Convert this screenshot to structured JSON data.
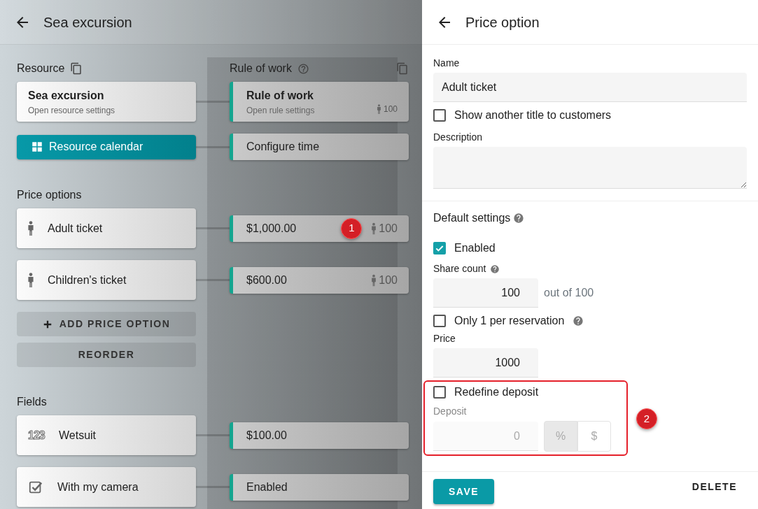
{
  "board": {
    "title": "Sea excursion",
    "rule_column": {
      "label": "Rule of work"
    },
    "sections": [
      {
        "label": "Resource",
        "rows": [
          {
            "kind": "resource",
            "title": "Sea excursion",
            "subtitle": "Open resource settings",
            "rule": {
              "title": "Rule of work",
              "subtitle": "Open rule settings",
              "count": "100"
            }
          },
          {
            "kind": "calendar",
            "title": "Resource calendar",
            "rule": {
              "title": "Configure time"
            }
          }
        ]
      },
      {
        "label": "Price options",
        "rows": [
          {
            "kind": "person",
            "title": "Adult ticket",
            "rule": {
              "title": "$1,000.00",
              "count": "100",
              "marker": "1"
            }
          },
          {
            "kind": "person",
            "title": "Children's ticket",
            "rule": {
              "title": "$600.00",
              "count": "100"
            }
          }
        ],
        "buttons": [
          {
            "kind": "add",
            "label": "ADD PRICE OPTION"
          },
          {
            "kind": "plain",
            "label": "REORDER"
          }
        ]
      },
      {
        "label": "Fields",
        "rows": [
          {
            "kind": "number",
            "icon_text": "123",
            "title": "Wetsuit",
            "rule": {
              "title": "$100.00"
            }
          },
          {
            "kind": "checkbox",
            "title": "With my camera",
            "rule": {
              "title": "Enabled"
            }
          }
        ]
      }
    ]
  },
  "panel": {
    "title": "Price option",
    "name": {
      "label": "Name",
      "value": "Adult ticket"
    },
    "alt_title": {
      "label": "Show another title to customers",
      "checked": false
    },
    "description": {
      "label": "Description"
    },
    "defaults": {
      "heading": "Default settings",
      "enabled": {
        "label": "Enabled",
        "checked": true
      },
      "share_count": {
        "label": "Share count",
        "value": "100",
        "suffix": "out of 100"
      },
      "one_per_reservation": {
        "label": "Only 1 per reservation",
        "checked": false
      },
      "price": {
        "label": "Price",
        "value": "1000"
      },
      "redefine_deposit": {
        "label": "Redefine deposit",
        "checked": false
      },
      "deposit": {
        "label": "Deposit",
        "value": "0",
        "disabled": true,
        "marker": "2",
        "units": [
          {
            "label": "%",
            "selected": true
          },
          {
            "label": "$",
            "selected": false
          }
        ]
      }
    },
    "actions": [
      {
        "kind": "primary",
        "label": "SAVE"
      },
      {
        "kind": "text",
        "label": "DELETE"
      }
    ]
  }
}
